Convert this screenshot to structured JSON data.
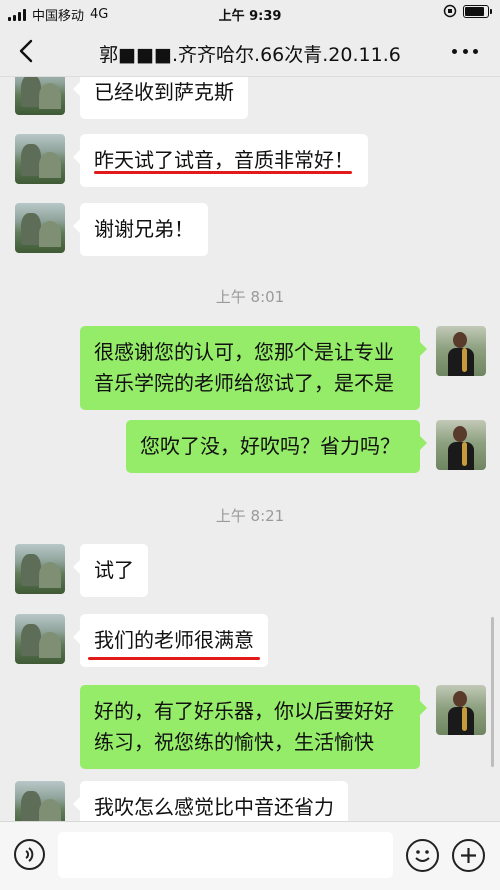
{
  "status_bar": {
    "carrier": "中国移动",
    "network": "4G",
    "time": "上午 9:39"
  },
  "nav": {
    "title": "郭■■■.齐齐哈尔.66次青.20.11.6"
  },
  "messages": [
    {
      "text": "已经收到萨克斯"
    },
    {
      "text": "昨天试了试音，音质非常好！"
    },
    {
      "text": "谢谢兄弟！"
    },
    {
      "time": "上午 8:01"
    },
    {
      "text": "很感谢您的认可，您那个是让专业音乐学院的老师给您试了，是不是"
    },
    {
      "text": "您吹了没，好吹吗？省力吗？"
    },
    {
      "time": "上午 8:21"
    },
    {
      "text": "试了"
    },
    {
      "text": "我们的老师很满意"
    },
    {
      "text": "好的，有了好乐器，你以后要好好练习，祝您练的愉快，生活愉快"
    },
    {
      "text": "我吹怎么感觉比中音还省力"
    }
  ],
  "highlight_color": "#e21a1a",
  "bubble_colors": {
    "incoming": "#ffffff",
    "outgoing": "#95ec69"
  }
}
